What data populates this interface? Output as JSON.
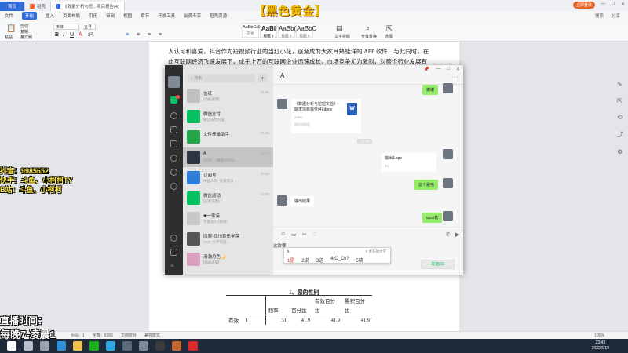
{
  "banner": "【黑色黄金】",
  "wps": {
    "tabs": [
      {
        "label": "首页",
        "type": "home"
      },
      {
        "label": "稻壳",
        "type": "normal"
      },
      {
        "label": "《数据分析与挖...项目报告(4)",
        "type": "active"
      }
    ],
    "login": "立即登录",
    "window_controls": [
      "—",
      "□",
      "✕"
    ],
    "menu": [
      "文件",
      "开始",
      "插入",
      "页面布局",
      "引用",
      "审阅",
      "视图",
      "章节",
      "开发工具",
      "会员专享",
      "稻壳资源"
    ],
    "menu_active": "开始",
    "menu_right": [
      "搜索",
      "分享"
    ],
    "ribbon": {
      "paste": "粘贴",
      "cut": "剪切",
      "copy": "复制",
      "format_painter": "格式刷",
      "font_name": "宋体",
      "font_size": "五号",
      "styles": [
        {
          "preview": "AaBbCcDi",
          "name": "正文"
        },
        {
          "preview": "AaBl",
          "name": "标题 1"
        },
        {
          "preview": "AaBb(",
          "name": "标题 2"
        },
        {
          "preview": "AaBbC",
          "name": "标题 3"
        }
      ],
      "text_layout": "文字排版",
      "find_replace": "查找替换",
      "select": "选择"
    }
  },
  "document": {
    "para_line1": "人认可和喜爱，抖音作为短视频行业的当红小花，逐渐成为大家耳熟能详的 APP 软件，与此同时，在",
    "para_line2": "此互联网经济飞速发展下，成千上万的互联网企业迅速成长，市场竞争尤为激烈，对整个行业发展有",
    "table_title": "1、您的性别",
    "table_header_top": [
      "",
      "",
      "",
      "",
      "有效百分",
      "累积百分"
    ],
    "table_header": [
      "",
      "",
      "频率",
      "百分比",
      "比",
      "比"
    ],
    "table_row": [
      "有效",
      "1",
      "31",
      "41.9",
      "41.9",
      "41.9"
    ]
  },
  "overlays": {
    "douyin": "抖音：9985652",
    "kuaishou": "快手：斗鱼、小柯柯TY",
    "bilibili": "B站：斗鱼、小柯柯",
    "live_time_label": "直播时间：",
    "live_time_value": "每晚7-凌晨1"
  },
  "statusbar": {
    "items": [
      "页码：1",
      "字数：5366",
      "文档校对",
      "兼容模式"
    ],
    "zoom": "100%"
  },
  "taskbar": {
    "time": "23:43",
    "date": "2022/6/19",
    "icons": [
      {
        "name": "start",
        "color": "#ffffff"
      },
      {
        "name": "search",
        "color": "#b7bfca"
      },
      {
        "name": "task-view",
        "color": "#9aa3ad"
      },
      {
        "name": "edge",
        "color": "#2f8fd8"
      },
      {
        "name": "explorer",
        "color": "#f0c14b"
      },
      {
        "name": "wechat",
        "color": "#1aad19"
      },
      {
        "name": "qq",
        "color": "#2ea8e5"
      },
      {
        "name": "app1",
        "color": "#5a6a7a"
      },
      {
        "name": "app2",
        "color": "#7c8896"
      },
      {
        "name": "obs",
        "color": "#3a3a3a"
      },
      {
        "name": "app3",
        "color": "#c46a2e"
      },
      {
        "name": "wps",
        "color": "#d62b2b"
      }
    ]
  },
  "wechat": {
    "search_placeholder": "搜索",
    "plus": "+",
    "conversations": [
      {
        "name": "信纸",
        "preview": "[动画表情]",
        "time": "21:00",
        "color": "#bfbfbf",
        "selected": false
      },
      {
        "name": "微信支付",
        "preview": "微信支付凭证",
        "time": "",
        "color": "#07c160",
        "selected": false
      },
      {
        "name": "文件传输助手",
        "preview": "",
        "time": "21:30",
        "color": "#26a64a",
        "selected": false
      },
      {
        "name": "A",
        "preview": "[文件] 《数据分析与...",
        "time": "23:40",
        "color": "#2b3440",
        "selected": true
      },
      {
        "name": "订阅号",
        "preview": "中国人保: 快来参与...",
        "time": "23:22",
        "color": "#2e7dd8",
        "selected": false
      },
      {
        "name": "微信运动",
        "preview": "[应用消息]",
        "time": "22:29",
        "color": "#07c160",
        "selected": false
      },
      {
        "name": "❤一家亲",
        "preview": "字客老人:[表情]",
        "time": "",
        "color": "#c8c8c8",
        "selected": false
      },
      {
        "name": "同盟-四川音乐学院",
        "preview": "XXX: 文字内容...",
        "time": "",
        "color": "#555555",
        "selected": false
      },
      {
        "name": "清澈月色🌙",
        "preview": "[动画表情]",
        "time": "",
        "color": "#d9a0c0",
        "selected": false
      }
    ],
    "chat_title": "A",
    "chat_controls": [
      "📌",
      "—",
      "□",
      "✕"
    ],
    "more": "···",
    "messages": {
      "xiexie": "谢谢",
      "file_name": "《数据分析与挖掘实验》期末项目报告(4).docx",
      "file_size": "249K",
      "file_source": "微信电脑版",
      "time_chip": "23:40",
      "spv_file": "输出1.spv",
      "spv_size": "4K",
      "zhege_ruanjian": "这个是啥",
      "shuchu_jieguo": "输出结果",
      "spss_ruanjian": "spss软"
    },
    "tools": [
      "☺",
      "▭",
      "✂",
      "◌"
    ],
    "call_icons": [
      "✆",
      "▶"
    ],
    "input_text": "这款要",
    "ime": {
      "pinyin": "s",
      "hint": "5 更多朋文字",
      "candidates": [
        "1是",
        "2说",
        "3送",
        "4(O_O)?",
        "5晓"
      ]
    },
    "send": "发送(S)"
  }
}
